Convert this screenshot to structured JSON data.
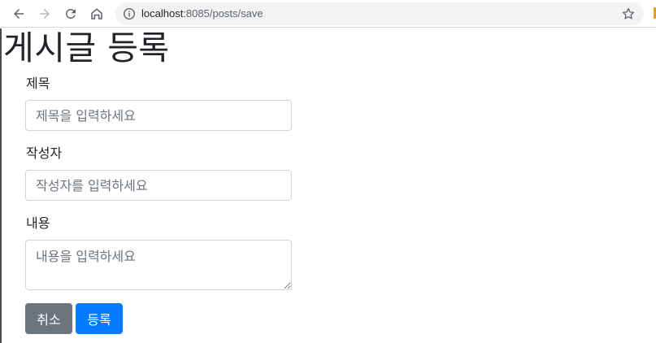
{
  "browser": {
    "url_host": "localhost",
    "url_rest": ":8085/posts/save"
  },
  "page": {
    "title": "게시글 등록"
  },
  "form": {
    "title_label": "제목",
    "title_placeholder": "제목을 입력하세요",
    "author_label": "작성자",
    "author_placeholder": "작성자를 입력하세요",
    "content_label": "내용",
    "content_placeholder": "내용을 입력하세요"
  },
  "buttons": {
    "cancel_label": "취소",
    "save_label": "등록"
  },
  "colors": {
    "cancel_button": "#6c757d",
    "save_button": "#007bff",
    "input_border": "#ced4da"
  },
  "icons": {
    "back": "back-arrow-icon",
    "forward": "forward-arrow-icon",
    "reload": "reload-icon",
    "home": "home-icon",
    "site_info": "info-icon",
    "bookmark": "star-icon"
  }
}
